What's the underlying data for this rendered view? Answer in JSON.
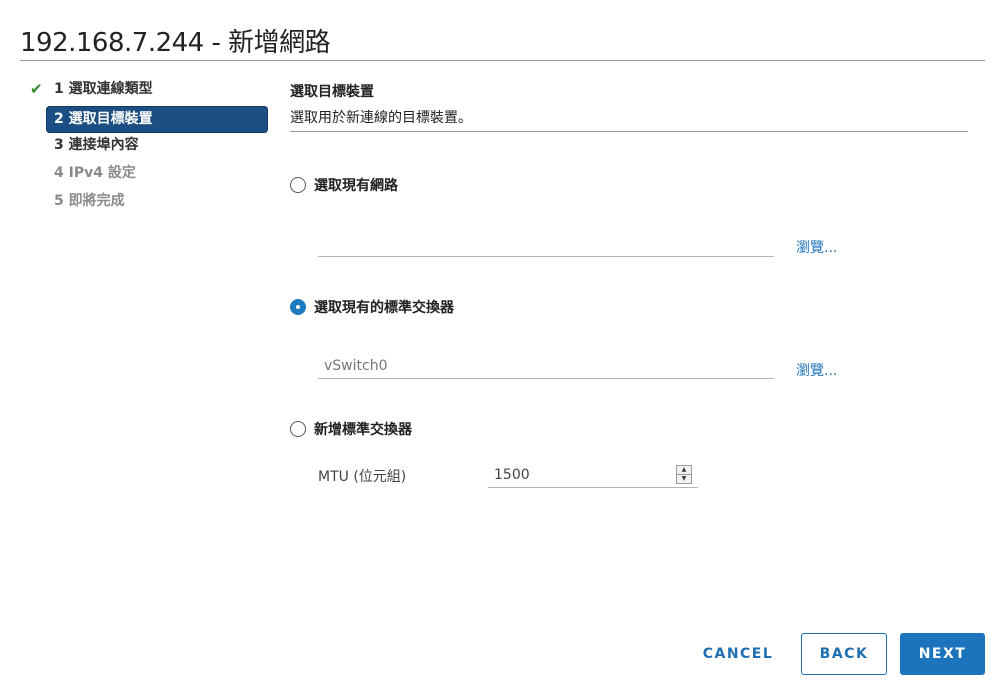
{
  "window": {
    "title": "192.168.7.244 - 新增網路"
  },
  "steps": [
    {
      "label": "1 選取連線類型",
      "state": "done"
    },
    {
      "label": "2 選取目標裝置",
      "state": "active"
    },
    {
      "label": "3 連接埠內容",
      "state": "done"
    },
    {
      "label": "4 IPv4 設定",
      "state": "pending"
    },
    {
      "label": "5 即將完成",
      "state": "pending"
    }
  ],
  "section": {
    "title": "選取目標裝置",
    "description": "選取用於新連線的目標裝置。"
  },
  "options": {
    "existing_network": {
      "label": "選取現有網路",
      "selected": false,
      "field_value": "",
      "browse_label": "瀏覽..."
    },
    "existing_switch": {
      "label": "選取現有的標準交換器",
      "selected": true,
      "field_placeholder": "vSwitch0",
      "browse_label": "瀏覽..."
    },
    "new_switch": {
      "label": "新增標準交換器",
      "selected": false,
      "mtu_label": "MTU (位元組)",
      "mtu_value": "1500"
    }
  },
  "footer": {
    "cancel_label": "CANCEL",
    "back_label": "BACK",
    "next_label": "NEXT"
  },
  "colors": {
    "accent": "#1c75bc",
    "active_step": "#1b4e82",
    "check": "#2f8b26"
  }
}
